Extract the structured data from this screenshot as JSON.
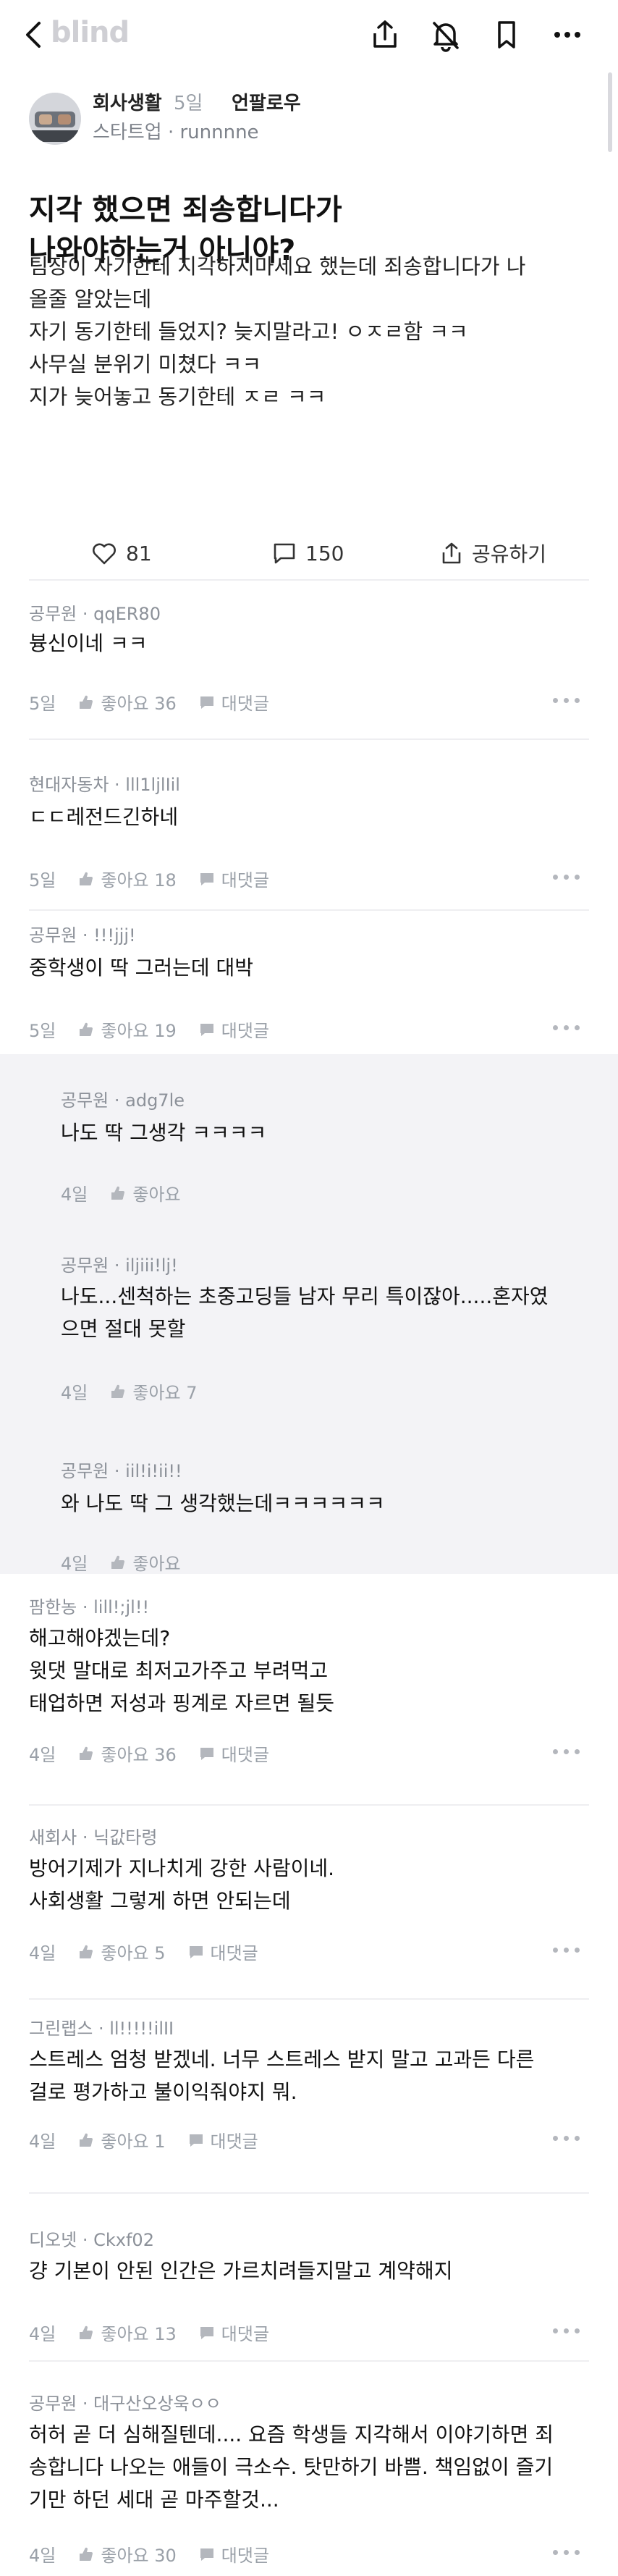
{
  "header": {
    "logo": "blind"
  },
  "post": {
    "category": "회사생활",
    "time": "5일",
    "follow_label": "언팔로우",
    "company": "스타트업 · runnnne",
    "title_lines": [
      "지각 했으면 죄송합니다가",
      "나와야하는거 아니야?"
    ],
    "body_lines": [
      "팀장이 자기한테 지각하지마세요 했는데 죄송합니다가 나",
      "올줄 알았는데",
      "자기 동기한테 들었지? 늦지말라고! ㅇㅈㄹ함 ㅋㅋ",
      "사무실 분위기 미쳤다 ㅋㅋ",
      "지가 늦어놓고 동기한테 ㅈㄹ ㅋㅋ"
    ],
    "likes": "81",
    "comments": "150",
    "share_label": "공유하기"
  },
  "comments": [
    {
      "meta": "공무원 · qqER80",
      "lines": [
        "븅신이네 ㅋㅋ"
      ],
      "time": "5일",
      "likes": "좋아요 36",
      "reply": "대댓글"
    },
    {
      "meta": "현대자동차 · lll1ljlIil",
      "lines": [
        "ㄷㄷ레전드긴하네"
      ],
      "time": "5일",
      "likes": "좋아요 18",
      "reply": "대댓글"
    },
    {
      "meta": "공무원 · !!!jjj!",
      "lines": [
        "중학생이 딱 그러는데 대박"
      ],
      "time": "5일",
      "likes": "좋아요 19",
      "reply": "대댓글"
    },
    {
      "meta": "공무원 · adg7le",
      "lines": [
        "나도 딱 그생각 ㅋㅋㅋㅋ"
      ],
      "time": "4일",
      "likes": "좋아요"
    },
    {
      "meta": "공무원 · iljiii!lj!",
      "lines": [
        "나도...센척하는 초중고딩들 남자 무리 특이잖아.....혼자였",
        "으면 절대 못할"
      ],
      "time": "4일",
      "likes": "좋아요 7"
    },
    {
      "meta": "공무원 · iil!i!ii!!",
      "lines": [
        "와 나도 딱 그 생각했는데ㅋㅋㅋㅋㅋㅋ"
      ],
      "time": "4일",
      "likes": "좋아요"
    },
    {
      "meta": "팜한농 · lill!;jl!!",
      "lines": [
        "해고해야겠는데?",
        "윗댓 말대로 최저고가주고 부려먹고",
        "태업하면 저성과 핑계로 자르면 될듯"
      ],
      "time": "4일",
      "likes": "좋아요 36",
      "reply": "대댓글"
    },
    {
      "meta": "새회사 · 닉값타령",
      "lines": [
        "방어기제가 지나치게 강한 사람이네.",
        "사회생활 그렇게 하면 안되는데"
      ],
      "time": "4일",
      "likes": "좋아요 5",
      "reply": "대댓글"
    },
    {
      "meta": "그린랩스 · ll!!!!!ilII",
      "lines": [
        "스트레스 엄청 받겠네. 너무 스트레스 받지 말고 고과든 다른",
        "걸로 평가하고 불이익줘야지 뭐."
      ],
      "time": "4일",
      "likes": "좋아요 1",
      "reply": "대댓글"
    },
    {
      "meta": "디오넷 · Ckxf02",
      "lines": [
        "걍 기본이 안된 인간은 가르치려들지말고 계약해지"
      ],
      "time": "4일",
      "likes": "좋아요 13",
      "reply": "대댓글"
    },
    {
      "meta": "공무원 · 대구산오상욱ㅇㅇ",
      "lines": [
        "허허 곧 더 심해질텐데.... 요즘 학생들 지각해서 이야기하면 죄",
        "송합니다 나오는 애들이 극소수. 탓만하기 바쁨. 책임없이 즐기",
        "기만 하던 세대 곧 마주할것..."
      ],
      "time": "4일",
      "likes": "좋아요 30",
      "reply": "대댓글"
    }
  ]
}
